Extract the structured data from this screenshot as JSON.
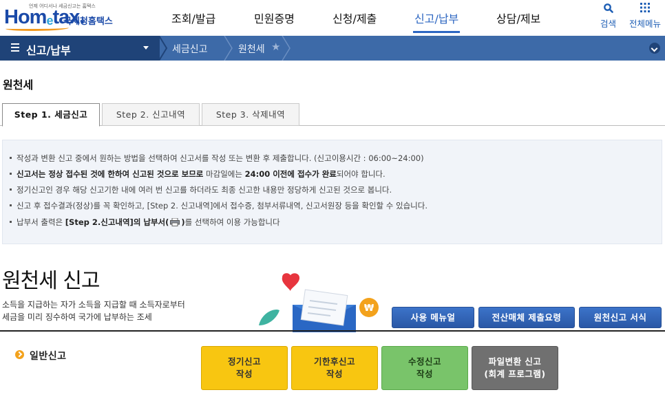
{
  "logo": {
    "subtitle": "언제 어디서나 세금신고는 홈택스",
    "main": "Hom",
    "main_e": "e",
    "main_rest": "tax.",
    "korean": "국세청홈택스"
  },
  "gnb": {
    "items": [
      {
        "label": "조회/발급"
      },
      {
        "label": "민원증명"
      },
      {
        "label": "신청/제출"
      },
      {
        "label": "신고/납부"
      },
      {
        "label": "상담/제보"
      }
    ],
    "search_label": "검색",
    "allmenu_label": "전체메뉴"
  },
  "nav": {
    "menu_label": "신고/납부",
    "crumbs": [
      "세금신고",
      "원천세"
    ]
  },
  "page_title": "원천세",
  "tabs": [
    {
      "label": "Step 1. 세금신고"
    },
    {
      "label": "Step 2. 신고내역"
    },
    {
      "label": "Step 3. 삭제내역"
    }
  ],
  "info": {
    "line1": "작성과 변환 신고 중에서 원하는 방법을 선택하여 신고서를 작성 또는 변환 후 제출합니다. (신고이용시간 : 06:00~24:00)",
    "line2a": "신고서는 정상 접수된 것에 한하여 신고된 것으로 보므로",
    "line2b": " 마감일에는 ",
    "line2c": "24:00 이전에 접수가 완료",
    "line2d": "되어야 합니다.",
    "line3": "정기신고인 경우 해당 신고기한 내에 여러 번 신고를 하더라도 최종 신고한 내용만 정당하게 신고된 것으로 봅니다.",
    "line4": "신고 후 접수결과(정상)를 꼭 확인하고, [Step 2. 신고내역]에서 접수증, 첨부서류내역, 신고서원장 등을 확인할 수 있습니다.",
    "line5a": "납부서 출력은 ",
    "line5b": "[Step 2.신고내역]의 납부서(",
    "line5c": ")",
    "line5d": "를 선택하여 이용 가능합니다"
  },
  "section": {
    "title": "원천세 신고",
    "desc1": "소득을 지급하는 자가 소득을 지급할 때 소득자로부터",
    "desc2": "세금을 미리 징수하여 국가에 납부하는 조세"
  },
  "menu_buttons": [
    {
      "label": "사용 메뉴얼"
    },
    {
      "label": "전산매체 제출요령"
    },
    {
      "label": "원천신고 서식"
    }
  ],
  "general": {
    "label": "일반신고"
  },
  "filing_buttons": [
    {
      "line1": "정기신고",
      "line2": "작성",
      "color": "#f8c611"
    },
    {
      "line1": "기한후신고",
      "line2": "작성",
      "color": "#f8c611"
    },
    {
      "line1": "수정신고",
      "line2": "작성",
      "color": "#79c46a"
    },
    {
      "line1": "파일변환 신고",
      "line2": "(회계 프로그램)",
      "color": "#707070"
    }
  ],
  "colors": {
    "brand": "#1b4aa8",
    "active_menu": "#2c66c1",
    "nav_bar": "#3d6aa8",
    "nav_menu": "#1f4378"
  }
}
